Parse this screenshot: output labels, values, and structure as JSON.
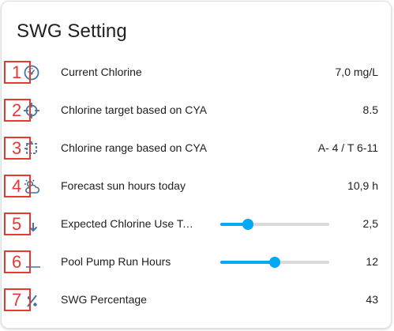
{
  "card": {
    "title": "SWG Setting"
  },
  "colors": {
    "accent": "#03a9f4",
    "icon": "#44739e",
    "annotation": "#e53935"
  },
  "rows": [
    {
      "num": "1",
      "icon": "gauge-icon",
      "label": "Current Chlorine",
      "value": "7,0 mg/L"
    },
    {
      "num": "2",
      "icon": "crosshairs-icon",
      "label": "Chlorine target based on CYA",
      "value": "8.5"
    },
    {
      "num": "3",
      "icon": "select-range-icon",
      "label": "Chlorine range based on CYA",
      "value": "A- 4 / T 6-11"
    },
    {
      "num": "4",
      "icon": "weather-partly-sunny-icon",
      "label": "Forecast sun hours today",
      "value": "10,9 h"
    },
    {
      "num": "5",
      "icon": "arrow-down-icon",
      "label": "Expected Chlorine Use Today",
      "value": "2,5",
      "slider_fraction": 0.25
    },
    {
      "num": "6",
      "icon": "pump-icon",
      "label": "Pool Pump Run Hours",
      "value": "12",
      "slider_fraction": 0.5
    },
    {
      "num": "7",
      "icon": "percent-icon",
      "label": "SWG Percentage",
      "value": "43"
    }
  ]
}
